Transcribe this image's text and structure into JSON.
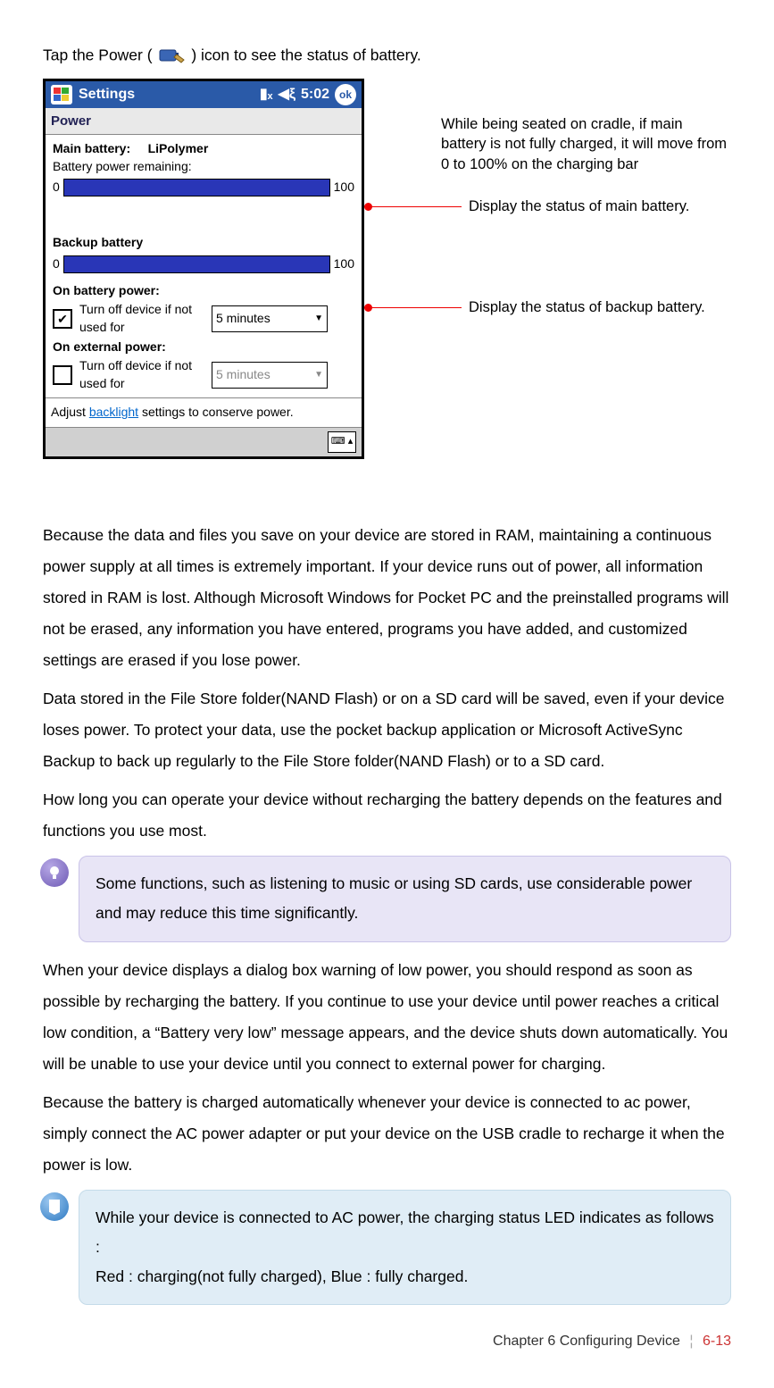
{
  "intro": {
    "before": "Tap the Power (",
    "after": ") icon to see the status of battery."
  },
  "screenshot": {
    "topbar": {
      "title": "Settings",
      "time": "5:02",
      "ok": "ok"
    },
    "subbar": "Power",
    "main": {
      "label": "Main battery:",
      "type": "LiPolymer",
      "remaining": "Battery power remaining:",
      "min": "0",
      "max": "100"
    },
    "backup": {
      "label": "Backup battery",
      "min": "0",
      "max": "100"
    },
    "onBattery": {
      "title": "On battery power:",
      "opt": "Turn off device if not used for",
      "value": "5 minutes"
    },
    "onExternal": {
      "title": "On external power:",
      "opt": "Turn off device if not used for",
      "value": "5 minutes"
    },
    "adjust": {
      "pre": "Adjust ",
      "link": "backlight",
      "post": " settings to conserve power."
    }
  },
  "annotations": {
    "topNote": "While being seated on cradle, if main battery is not fully charged, it will move from 0 to 100% on the charging bar",
    "mainStatus": "Display the status of main battery.",
    "backupStatus": "Display the status of backup battery."
  },
  "para1": "Because the data and files you save on your device are stored in RAM, maintaining a continuous power supply at all times is extremely important. If your device runs out of power, all information stored in RAM is lost. Although Microsoft Windows for Pocket PC and the preinstalled programs will not be erased, any information you have entered, programs you have added, and customized settings are erased if you lose power.",
  "para2": "Data stored in the File Store folder(NAND Flash) or on a SD card will be saved, even if your device loses power. To protect your data, use the pocket backup application or Microsoft ActiveSync Backup to back up regularly to the File Store folder(NAND Flash) or to a SD card.",
  "para3": "How long you can operate your device without recharging the battery depends on the features and functions you use most.",
  "note1": "Some functions, such as listening to music or using SD cards, use considerable power and may reduce this time significantly.",
  "para4": "When your device displays a dialog box warning of low power, you should respond as soon as possible by recharging the battery. If you continue to use your device until power reaches a critical low condition, a “Battery very low” message appears, and the device shuts down automatically. You will be unable to use your device until you connect to external power for charging.",
  "para5": "Because the battery is charged automatically whenever your device is connected to ac power, simply connect the AC power adapter or put your device on the USB cradle to recharge it when the power is low.",
  "note2": "While your device is connected to AC power, the charging status LED indicates as follows :\nRed : charging(not fully charged), Blue : fully charged.",
  "footer": {
    "chapter": "Chapter 6  Configuring Device",
    "page": "6-13"
  }
}
